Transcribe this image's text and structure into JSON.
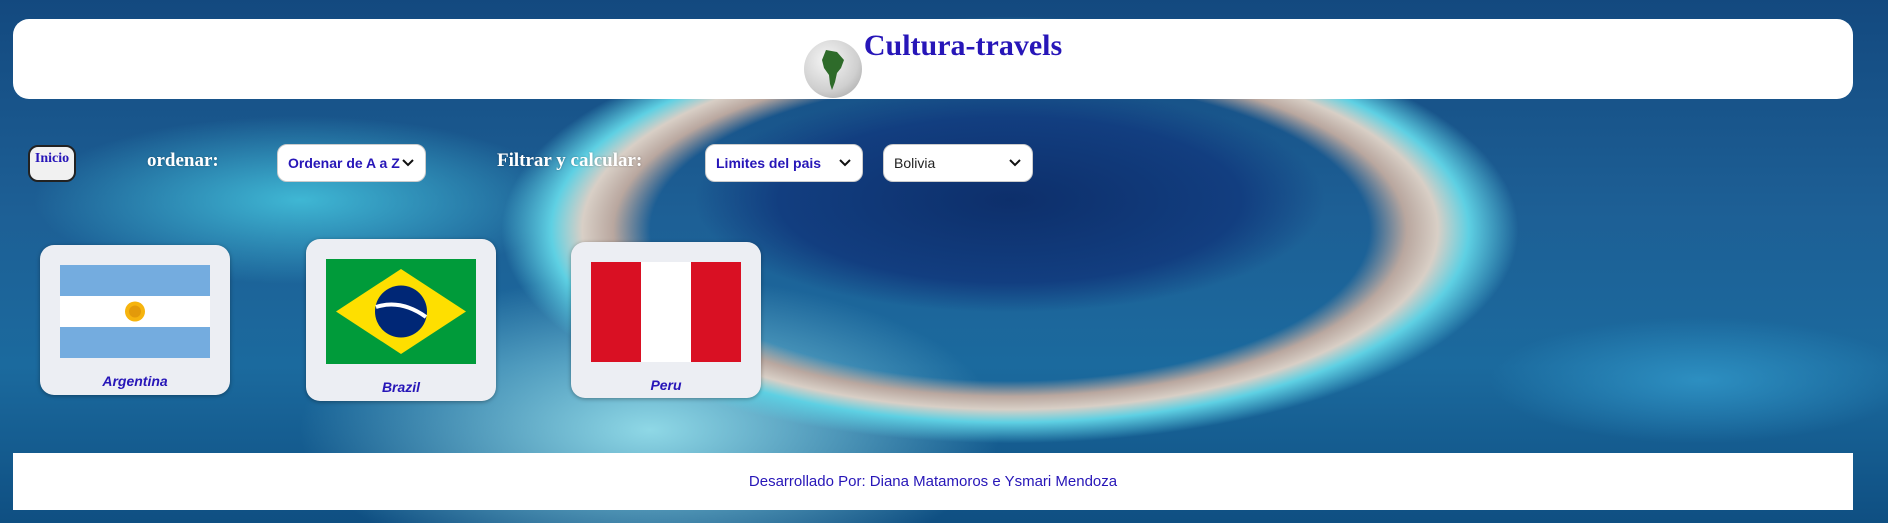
{
  "header": {
    "title": "Cultura-travels",
    "logo_icon": "south-america-globe-icon"
  },
  "toolbar": {
    "home_label": "Inicio",
    "order_label": "ordenar:",
    "order_select": {
      "value": "Ordenar de A a Z"
    },
    "filter_label": "Filtrar y calcular:",
    "filter_select": {
      "value": "Limites del pais"
    },
    "country_select": {
      "value": "Bolivia"
    }
  },
  "countries": [
    {
      "name": "Argentina",
      "flag_icon": "argentina-flag-icon"
    },
    {
      "name": "Brazil",
      "flag_icon": "brazil-flag-icon"
    },
    {
      "name": "Peru",
      "flag_icon": "peru-flag-icon"
    }
  ],
  "footer": {
    "text": "Desarrollado Por: Diana Matamoros e Ysmari Mendoza"
  },
  "colors": {
    "accent": "#2716b8",
    "card_bg": "#eceef3"
  }
}
